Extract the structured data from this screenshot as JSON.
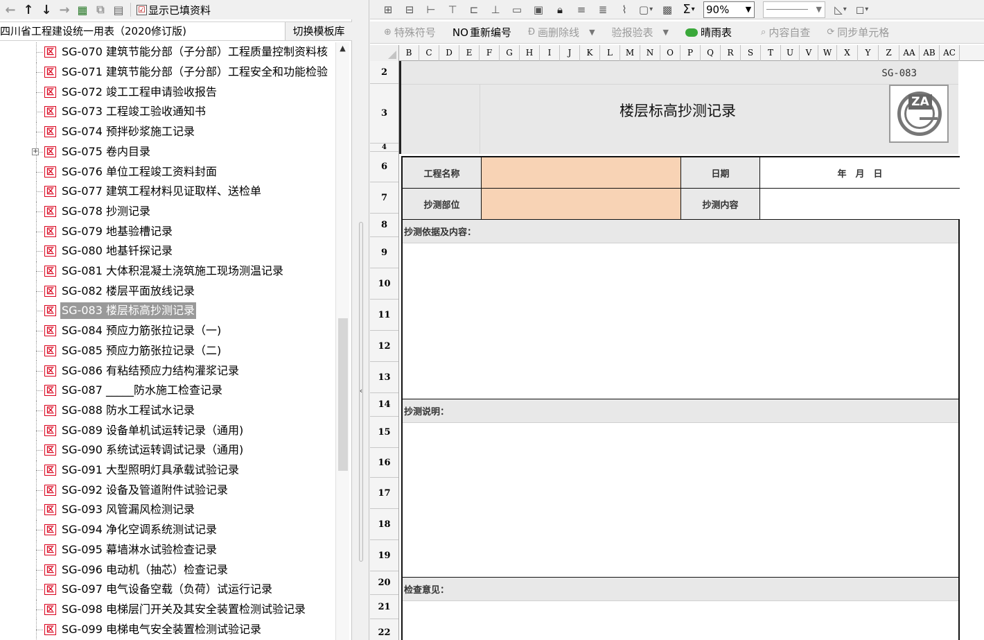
{
  "left_toolbar": {
    "buttons": [
      {
        "name": "back-arrow-icon",
        "glyph": "←"
      },
      {
        "name": "up-arrow-icon",
        "glyph": "↑"
      },
      {
        "name": "down-arrow-icon",
        "glyph": "↓"
      },
      {
        "name": "forward-arrow-icon",
        "glyph": "→"
      },
      {
        "name": "grid-add-icon",
        "glyph": "▦"
      },
      {
        "name": "copy-icon",
        "glyph": "⧉"
      },
      {
        "name": "sheet-icon",
        "glyph": "▤"
      }
    ],
    "show_filled_label": "显示已填资料",
    "show_filled_checked": true
  },
  "left_header": {
    "template_title": "四川省工程建设统一用表（2020修订版)",
    "switch_template_label": "切换模板库"
  },
  "tree": {
    "items": [
      {
        "label": "SG-070 建筑节能分部（子分部）工程质量控制资料核",
        "expandable": false,
        "selected": false
      },
      {
        "label": "SG-071 建筑节能分部（子分部）工程安全和功能检验",
        "expandable": false,
        "selected": false
      },
      {
        "label": "SG-072 竣工工程申请验收报告",
        "expandable": false,
        "selected": false
      },
      {
        "label": "SG-073 工程竣工验收通知书",
        "expandable": false,
        "selected": false
      },
      {
        "label": "SG-074 预拌砂浆施工记录",
        "expandable": false,
        "selected": false
      },
      {
        "label": "SG-075 卷内目录",
        "expandable": true,
        "selected": false
      },
      {
        "label": "SG-076 单位工程竣工资料封面",
        "expandable": false,
        "selected": false
      },
      {
        "label": "SG-077 建筑工程材料见证取样、送检单",
        "expandable": false,
        "selected": false
      },
      {
        "label": "SG-078 抄测记录",
        "expandable": false,
        "selected": false
      },
      {
        "label": "SG-079 地基验槽记录",
        "expandable": false,
        "selected": false
      },
      {
        "label": "SG-080 地基钎探记录",
        "expandable": false,
        "selected": false
      },
      {
        "label": "SG-081 大体积混凝土浇筑施工现场测温记录",
        "expandable": false,
        "selected": false
      },
      {
        "label": "SG-082 楼层平面放线记录",
        "expandable": false,
        "selected": false
      },
      {
        "label": "SG-083 楼层标高抄测记录",
        "expandable": false,
        "selected": true
      },
      {
        "label": "SG-084 预应力筋张拉记录（一)",
        "expandable": false,
        "selected": false
      },
      {
        "label": "SG-085 预应力筋张拉记录（二)",
        "expandable": false,
        "selected": false
      },
      {
        "label": "SG-086 有粘结预应力结构灌浆记录",
        "expandable": false,
        "selected": false
      },
      {
        "label": "SG-087 _____防水施工检查记录",
        "expandable": false,
        "selected": false
      },
      {
        "label": "SG-088 防水工程试水记录",
        "expandable": false,
        "selected": false
      },
      {
        "label": "SG-089 设备单机试运转记录（通用)",
        "expandable": false,
        "selected": false
      },
      {
        "label": "SG-090 系统试运转调试记录（通用)",
        "expandable": false,
        "selected": false
      },
      {
        "label": "SG-091 大型照明灯具承载试验记录",
        "expandable": false,
        "selected": false
      },
      {
        "label": "SG-092 设备及管道附件试验记录",
        "expandable": false,
        "selected": false
      },
      {
        "label": "SG-093 风管漏风检测记录",
        "expandable": false,
        "selected": false
      },
      {
        "label": "SG-094 净化空调系统测试记录",
        "expandable": false,
        "selected": false
      },
      {
        "label": "SG-095 幕墙淋水试验检查记录",
        "expandable": false,
        "selected": false
      },
      {
        "label": "SG-096 电动机（抽芯）检查记录",
        "expandable": false,
        "selected": false
      },
      {
        "label": "SG-097 电气设备空载（负荷）试运行记录",
        "expandable": false,
        "selected": false
      },
      {
        "label": "SG-098 电梯层门开关及其安全装置检测试验记录",
        "expandable": false,
        "selected": false
      },
      {
        "label": "SG-099 电梯电气安全装置检测试验记录",
        "expandable": false,
        "selected": false
      }
    ]
  },
  "right_toolbar1": {
    "icons": [
      "merge-cells-icon",
      "split-cells-icon",
      "insert-col-icon",
      "insert-row-icon",
      "align-left-icon",
      "align-center-icon",
      "print-area-icon",
      "save-icon",
      "lock-icon",
      "indent-icon",
      "outdent-icon",
      "format-painter-icon",
      "image-icon",
      "calc-icon",
      "sum-icon"
    ],
    "zoom": "90%"
  },
  "right_toolbar2": {
    "special_symbol": "特殊符号",
    "renumber_no": "NO",
    "renumber": "重新编号",
    "strikethrough": "画删除线",
    "verify_table": "验报验表",
    "weather_table": "晴雨表",
    "content_check": "内容自查",
    "sync_cells": "同步单元格"
  },
  "grid": {
    "columns": [
      "B",
      "C",
      "D",
      "E",
      "F",
      "G",
      "H",
      "I",
      "J",
      "K",
      "L",
      "M",
      "N",
      "O",
      "P",
      "Q",
      "R",
      "S",
      "T",
      "U",
      "V",
      "W",
      "X",
      "Y",
      "Z",
      "AA",
      "AB",
      "AC"
    ],
    "rows": [
      "2",
      "3",
      "4",
      "6",
      "7",
      "8",
      "9",
      "10",
      "11",
      "12",
      "13",
      "14",
      "15",
      "16",
      "17",
      "18",
      "19",
      "20",
      "21",
      "22"
    ]
  },
  "form": {
    "code": "SG-083",
    "title": "楼层标高抄测记录",
    "logo_text": "ZA",
    "project_name_label": "工程名称",
    "date_label": "日期",
    "date_value": "年　月　日",
    "survey_location_label": "抄测部位",
    "survey_content_label": "抄测内容",
    "basis_label": "抄测依据及内容：",
    "notes_label": "抄测说明：",
    "review_label": "检查意见：",
    "fill_color": "#f8d3b5"
  }
}
